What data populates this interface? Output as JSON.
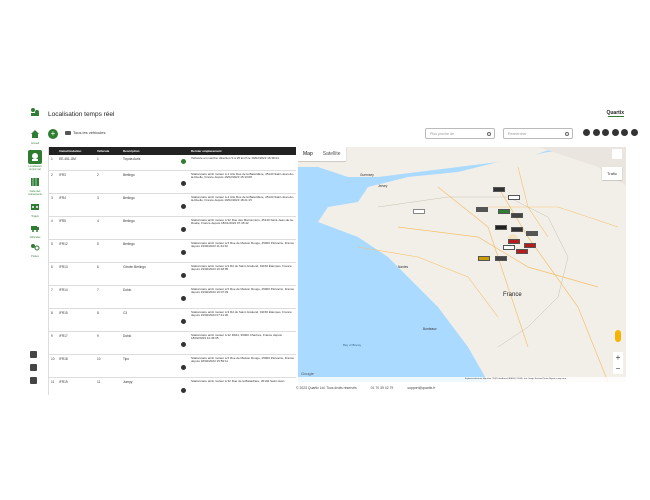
{
  "header": {
    "title": "Localisation temps réel",
    "brand": "Quartix"
  },
  "sidebar": {
    "items": [
      {
        "label": "Accueil",
        "icon": "home-icon"
      },
      {
        "label": "Localisation temps réel",
        "icon": "location-icon"
      },
      {
        "label": "Carte des événements",
        "icon": "map-icon"
      },
      {
        "label": "Trajets",
        "icon": "route-icon"
      },
      {
        "label": "Véhicules",
        "icon": "truck-icon"
      },
      {
        "label": "Postes",
        "icon": "poi-icon"
      }
    ]
  },
  "toolbar": {
    "vehicle_filter": "Tous les véhicules",
    "near_placeholder": "Plus proche de",
    "search_placeholder": "Rechercher"
  },
  "table": {
    "headers": [
      "",
      "Immatriculation",
      "Véhicule",
      "Description",
      "",
      "Dernier emplacement"
    ],
    "rows": [
      {
        "n": "1",
        "plate": "EE-451-GM",
        "veh": "1",
        "desc": "Toyota Auris",
        "loc": "Véhicule en marche: direction S à 25 km/h le 19/02/2023 16:38:24",
        "green": true
      },
      {
        "n": "2",
        "plate": "IFR3",
        "veh": "2",
        "desc": "Berlingo",
        "loc": "Stationnaire arrêt moteur à 4 Ulis Rue de la Batardière, 45140 Saint-Jean-de-la-Ruelle, France depuis 19/02/2023 15:10:08",
        "green": false
      },
      {
        "n": "3",
        "plate": "IFR4",
        "veh": "3",
        "desc": "Berlingo",
        "loc": "Stationnaire arrêt moteur à 4 Ulis Rue de la Batardière, 45140 Saint-Jean-de-la-Ruelle, France depuis 19/02/2023 18:21:15",
        "green": false
      },
      {
        "n": "4",
        "plate": "IFR5",
        "veh": "4",
        "desc": "Berlingo",
        "loc": "Stationnaire arrêt moteur à 32 Rue des Marronniers, 45140 Saint-Jean-de-la-Ruelle, France depuis 18/01/2023 07:45:42",
        "green": false
      },
      {
        "n": "5",
        "plate": "IFR12",
        "veh": "5",
        "desc": "Berlingo",
        "loc": "Stationnaire arrêt moteur à 5 Rue de Maison Rouge, 45000 Périvains, France depuis 19/02/2023 11:44:10",
        "green": false
      },
      {
        "n": "6",
        "plate": "IFR13",
        "veh": "6",
        "desc": "Citroën Berlingo",
        "loc": "Stationnaire arrêt moteur à 9 Rd du Saint-Gratiend, 91150 Étampes, France depuis 19/02/2023 16:18:05",
        "green": false
      },
      {
        "n": "7",
        "plate": "IFR14",
        "veh": "7",
        "desc": "Doblo",
        "loc": "Stationnaire arrêt moteur à 5 Rue de Maison Rouge, 45000 Périvains, France depuis 19/02/2023 16:07:49",
        "green": false
      },
      {
        "n": "8",
        "plate": "IFR15",
        "veh": "8",
        "desc": "C3",
        "loc": "Stationnaire arrêt moteur à 9 Rd du Saint-Gratiend, 91150 Étampes, France depuis 19/02/2023 07:41:30",
        "green": false
      },
      {
        "n": "9",
        "plate": "IFR17",
        "veh": "9",
        "desc": "Doblo",
        "loc": "Stationnaire arrêt moteur à 32 D944, 36000 Chartres, France depuis 18/02/2023 12:46:05",
        "green": false
      },
      {
        "n": "10",
        "plate": "IFR18",
        "veh": "10",
        "desc": "Tipo",
        "loc": "Stationnaire arrêt moteur à 5 Rue de Maison Rouge, 45000 Périvains, France depuis 18/02/2023 15:59:11",
        "green": false
      },
      {
        "n": "11",
        "plate": "IFR19",
        "veh": "11",
        "desc": "Jumpy",
        "loc": "Stationnaire arrêt moteur à 32 Rue de la Batardière, 45140 Saint-Jean",
        "green": false
      }
    ]
  },
  "map": {
    "tab_map": "Map",
    "tab_satellite": "Satellite",
    "traffic": "Trafic",
    "google": "Google",
    "footer": "Keyboard shortcuts   Map data ©2023 GeoBasis-DE/BKG (©2009), Inst. Geogr. Nacional   Terms   Report a map error",
    "labels": {
      "guernsey": "Guernsey",
      "jersey": "Jersey",
      "france": "France",
      "nantes": "Nantes",
      "biscay": "Bay of Biscay",
      "bordeaux": "Bordeaux"
    }
  },
  "footer": {
    "copyright": "© 2023 Quartix Ltd. Tous droits réservés",
    "phone": "01 70 39 42 79",
    "email": "support@quartix.fr"
  },
  "colors": {
    "accent": "#2e7d32",
    "header_dark": "#222222",
    "sea": "#aadaff",
    "land": "#f2efe9"
  }
}
